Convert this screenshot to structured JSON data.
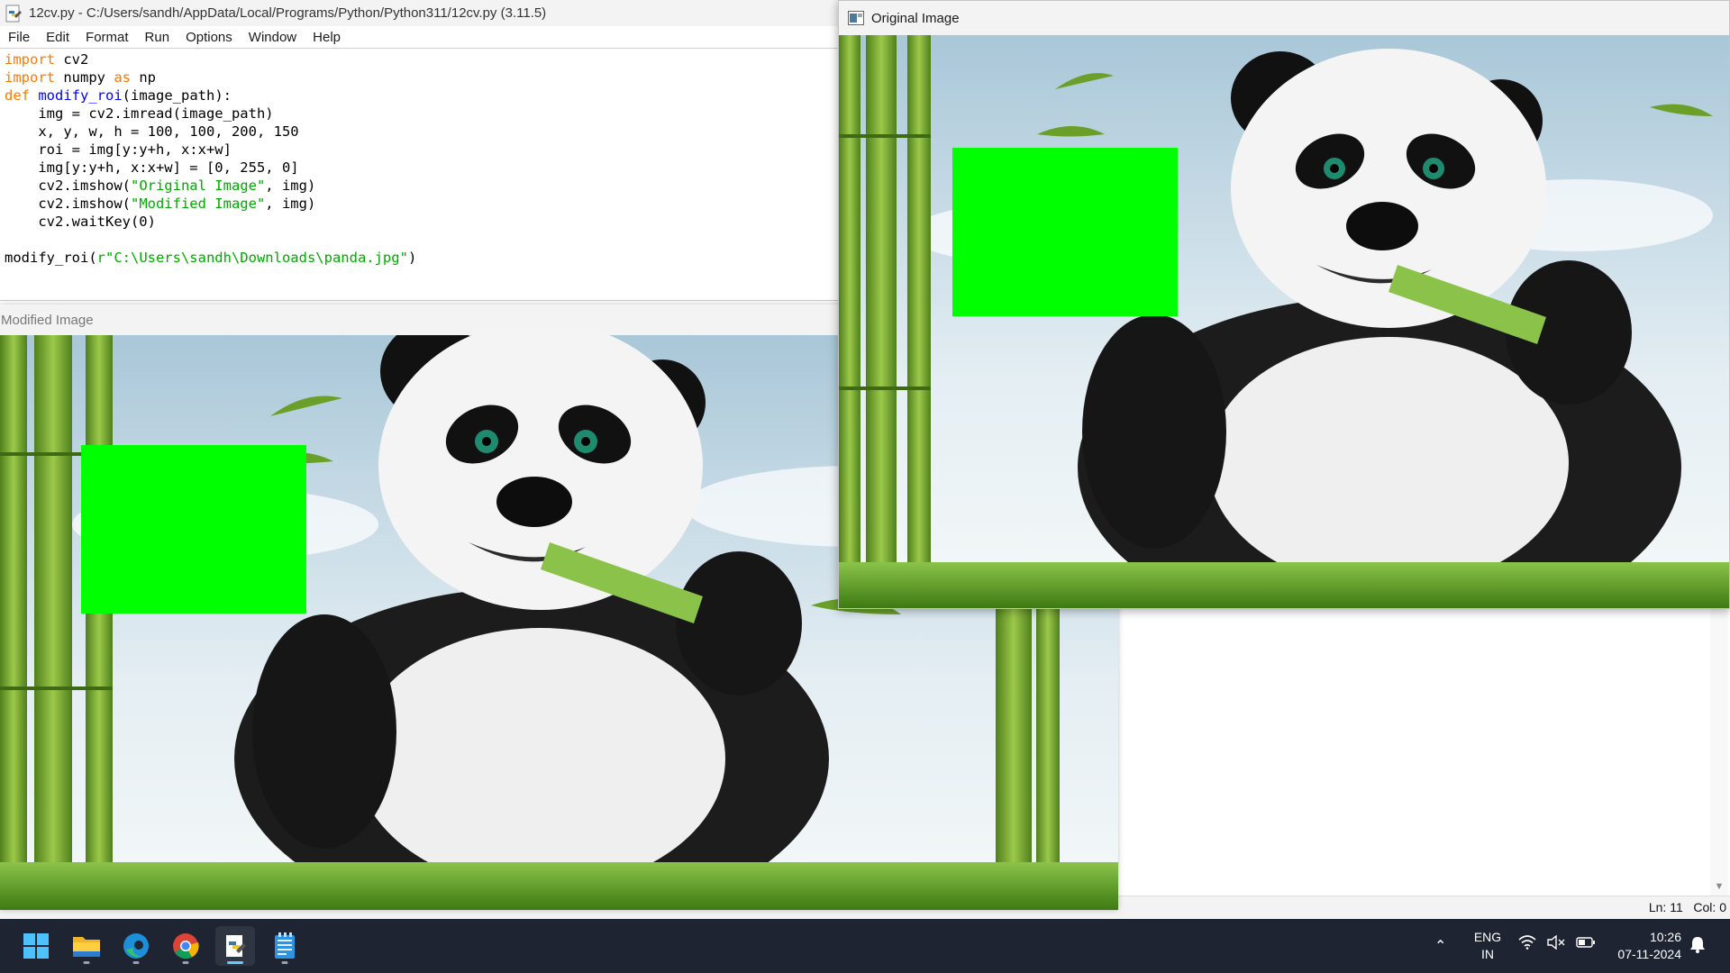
{
  "idle": {
    "title": "12cv.py - C:/Users/sandh/AppData/Local/Programs/Python/Python311/12cv.py (3.11.5)",
    "menu": [
      "File",
      "Edit",
      "Format",
      "Run",
      "Options",
      "Window",
      "Help"
    ],
    "code": {
      "l1_kw": "import",
      "l1_rest": " cv2",
      "l2_kw": "import",
      "l2_mid": " numpy ",
      "l2_kw2": "as",
      "l2_rest": " np",
      "l3_kw": "def",
      "l3_sp": " ",
      "l3_name": "modify_roi",
      "l3_rest": "(image_path):",
      "l4": "    img = cv2.imread(image_path)",
      "l5": "    x, y, w, h = 100, 100, 200, 150",
      "l6": "    roi = img[y:y+h, x:x+w]",
      "l7": "    img[y:y+h, x:x+w] = [0, 255, 0]",
      "l8_a": "    cv2.imshow(",
      "l8_s": "\"Original Image\"",
      "l8_b": ", img)",
      "l9_a": "    cv2.imshow(",
      "l9_s": "\"Modified Image\"",
      "l9_b": ", img)",
      "l10": "    cv2.waitKey(0)",
      "l12_a": "modify_roi(",
      "l12_s": "r\"C:\\Users\\sandh\\Downloads\\panda.jpg\"",
      "l12_b": ")"
    },
    "status": "Ln: 11   Col: 0"
  },
  "windows": {
    "modified_title": "Modified Image",
    "original_title": "Original Image"
  },
  "roi_color": "#00ff00",
  "taskbar": {
    "apps": [
      "windows-start-icon",
      "file-explorer-icon",
      "edge-browser-icon",
      "chrome-browser-icon",
      "idle-python-icon",
      "notepad-icon"
    ],
    "lang_line1": "ENG",
    "lang_line2": "IN",
    "time": "10:26",
    "date": "07-11-2024"
  }
}
